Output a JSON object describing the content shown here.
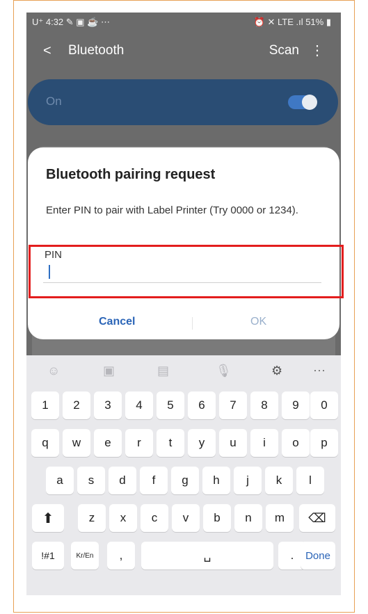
{
  "status": {
    "left": "U⁺ 4:32 ✎ ▣ ☕ ⋯",
    "right": "⏰ ✕ LTE .ıl 51% ▮"
  },
  "appbar": {
    "title": "Bluetooth",
    "scan": "Scan",
    "back_glyph": "<",
    "more_glyph": "⋮"
  },
  "onbar": {
    "label": "On"
  },
  "dialog": {
    "title": "Bluetooth pairing request",
    "message": "Enter PIN to pair with Label Printer (Try 0000 or 1234).",
    "pin_label": "PIN",
    "cancel": "Cancel",
    "ok": "OK"
  },
  "keyboard": {
    "icons": [
      "emoji-icon",
      "sticker-icon",
      "gif-icon",
      "mic-icon",
      "settings-icon",
      "more-icon"
    ],
    "row1": [
      "1",
      "2",
      "3",
      "4",
      "5",
      "6",
      "7",
      "8",
      "9",
      "0"
    ],
    "row2": [
      "q",
      "w",
      "e",
      "r",
      "t",
      "y",
      "u",
      "i",
      "o",
      "p"
    ],
    "row3": [
      "a",
      "s",
      "d",
      "f",
      "g",
      "h",
      "j",
      "k",
      "l"
    ],
    "row4": [
      "z",
      "x",
      "c",
      "v",
      "b",
      "n",
      "m"
    ],
    "row5": {
      "symbols": "!#1",
      "lang": "Kr/En",
      "comma": ",",
      "period": ".",
      "done": "Done"
    }
  }
}
